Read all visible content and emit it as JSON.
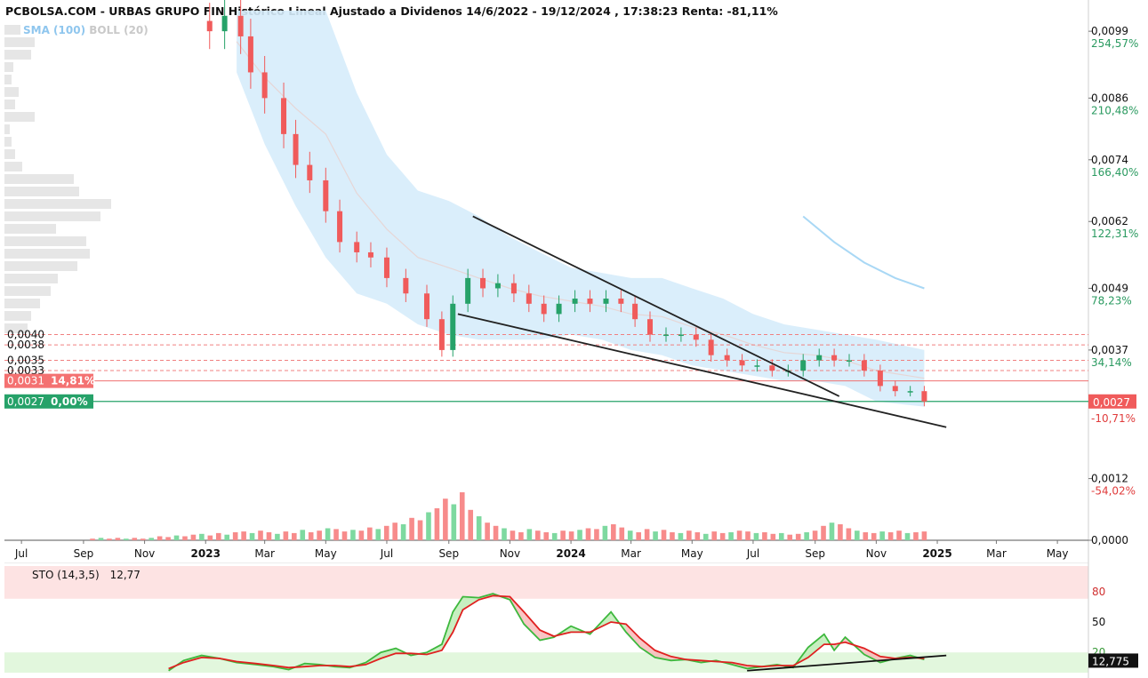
{
  "header": {
    "title": "PCBOLSA.COM - URBAS GRUPO FIN Histórico Lineal Ajustado a Dividenos 14/6/2022 - 19/12/2024 , 17:38:23 Renta: -81,11%",
    "indicator_sma": "SMA (100)",
    "indicator_boll": "BOLL (20)"
  },
  "colors": {
    "up": "#26a269",
    "down": "#f05b5b",
    "volume_up": "#7ed9a0",
    "volume_down": "#f78b8b",
    "bollinger_band": "#d6ecfb",
    "sma": "#a9d8f5",
    "sto_k": "#3db83d",
    "sto_d": "#e02020",
    "trendline": "#222222"
  },
  "chart_data": [
    {
      "type": "candlestick",
      "title": "",
      "ylim": [
        0,
        0.0103
      ],
      "y_ticks": [
        {
          "value": 0.0099,
          "label": "0,0099",
          "pct": "254,57%"
        },
        {
          "value": 0.0086,
          "label": "0,0086",
          "pct": "210,48%"
        },
        {
          "value": 0.0074,
          "label": "0,0074",
          "pct": "166,40%"
        },
        {
          "value": 0.0062,
          "label": "0,0062",
          "pct": "122,31%"
        },
        {
          "value": 0.0049,
          "label": "0,0049",
          "pct": "78,23%"
        },
        {
          "value": 0.0037,
          "label": "0,0037",
          "pct": "34,14%"
        },
        {
          "value": 0.0012,
          "label": "0,0012",
          "pct": "-54,02%"
        },
        {
          "value": 0.0,
          "label": "0,0000",
          "pct": ""
        }
      ],
      "x_ticks": [
        {
          "label": "Jul",
          "date": "2022-07-01",
          "bold": false
        },
        {
          "label": "Sep",
          "date": "2022-09-01",
          "bold": false
        },
        {
          "label": "Nov",
          "date": "2022-11-01",
          "bold": false
        },
        {
          "label": "2023",
          "date": "2023-01-01",
          "bold": true
        },
        {
          "label": "Mar",
          "date": "2023-03-01",
          "bold": false
        },
        {
          "label": "May",
          "date": "2023-05-01",
          "bold": false
        },
        {
          "label": "Jul",
          "date": "2023-07-01",
          "bold": false
        },
        {
          "label": "Sep",
          "date": "2023-09-01",
          "bold": false
        },
        {
          "label": "Nov",
          "date": "2023-11-01",
          "bold": false
        },
        {
          "label": "2024",
          "date": "2024-01-01",
          "bold": true
        },
        {
          "label": "Mar",
          "date": "2024-03-01",
          "bold": false
        },
        {
          "label": "May",
          "date": "2024-05-01",
          "bold": false
        },
        {
          "label": "Jul",
          "date": "2024-07-01",
          "bold": false
        },
        {
          "label": "Sep",
          "date": "2024-09-01",
          "bold": false
        },
        {
          "label": "Nov",
          "date": "2024-11-01",
          "bold": false
        },
        {
          "label": "2025",
          "date": "2025-01-01",
          "bold": true
        },
        {
          "label": "Mar",
          "date": "2025-03-01",
          "bold": false
        },
        {
          "label": "May",
          "date": "2025-05-01",
          "bold": false
        }
      ],
      "x_range": [
        "2022-06-14",
        "2025-06-01"
      ],
      "last_price": {
        "label": "0,0027",
        "pct": "-10,71%",
        "value": 0.0027
      },
      "price_levels": [
        {
          "value": 0.004,
          "label": "0,0040",
          "style": "dashed"
        },
        {
          "value": 0.0038,
          "label": "0,0038",
          "style": "dashed"
        },
        {
          "value": 0.0035,
          "label": "0,0035",
          "style": "dashed"
        },
        {
          "value": 0.0033,
          "label": "0,0033",
          "style": "dashed"
        },
        {
          "value": 0.0031,
          "label": "0,0031",
          "pct": "14,81%",
          "style": "solid-red"
        },
        {
          "value": 0.0027,
          "label": "0,0027",
          "pct": "0,00%",
          "style": "solid-green"
        }
      ],
      "close_points": [
        [
          "2022-12-28",
          0.0101
        ],
        [
          "2023-01-05",
          0.0099
        ],
        [
          "2023-01-20",
          0.0102
        ],
        [
          "2023-02-05",
          0.0098
        ],
        [
          "2023-02-15",
          0.0091
        ],
        [
          "2023-03-01",
          0.0086
        ],
        [
          "2023-03-20",
          0.0079
        ],
        [
          "2023-04-01",
          0.0073
        ],
        [
          "2023-04-15",
          0.007
        ],
        [
          "2023-05-01",
          0.0064
        ],
        [
          "2023-05-15",
          0.0058
        ],
        [
          "2023-06-01",
          0.0056
        ],
        [
          "2023-06-15",
          0.0055
        ],
        [
          "2023-07-01",
          0.0051
        ],
        [
          "2023-07-20",
          0.0048
        ],
        [
          "2023-08-10",
          0.0043
        ],
        [
          "2023-08-25",
          0.0037
        ],
        [
          "2023-09-05",
          0.0046
        ],
        [
          "2023-09-20",
          0.0051
        ],
        [
          "2023-10-05",
          0.0049
        ],
        [
          "2023-10-20",
          0.005
        ],
        [
          "2023-11-05",
          0.0048
        ],
        [
          "2023-11-20",
          0.0046
        ],
        [
          "2023-12-05",
          0.0044
        ],
        [
          "2023-12-20",
          0.0046
        ],
        [
          "2024-01-05",
          0.0047
        ],
        [
          "2024-01-20",
          0.0046
        ],
        [
          "2024-02-05",
          0.0047
        ],
        [
          "2024-02-20",
          0.0046
        ],
        [
          "2024-03-05",
          0.0043
        ],
        [
          "2024-03-20",
          0.004
        ],
        [
          "2024-04-05",
          0.004
        ],
        [
          "2024-04-20",
          0.004
        ],
        [
          "2024-05-05",
          0.0039
        ],
        [
          "2024-05-20",
          0.0036
        ],
        [
          "2024-06-05",
          0.0035
        ],
        [
          "2024-06-20",
          0.0034
        ],
        [
          "2024-07-05",
          0.0034
        ],
        [
          "2024-07-20",
          0.0033
        ],
        [
          "2024-08-05",
          0.0033
        ],
        [
          "2024-08-20",
          0.0035
        ],
        [
          "2024-09-05",
          0.0036
        ],
        [
          "2024-09-20",
          0.0035
        ],
        [
          "2024-10-05",
          0.0035
        ],
        [
          "2024-10-20",
          0.0033
        ],
        [
          "2024-11-05",
          0.003
        ],
        [
          "2024-11-20",
          0.0029
        ],
        [
          "2024-12-05",
          0.0029
        ],
        [
          "2024-12-19",
          0.0027
        ]
      ],
      "bollinger_upper": [
        [
          "2023-02-01",
          0.0103
        ],
        [
          "2023-03-01",
          0.0103
        ],
        [
          "2023-04-01",
          0.0103
        ],
        [
          "2023-05-01",
          0.0103
        ],
        [
          "2023-06-01",
          0.0087
        ],
        [
          "2023-07-01",
          0.0075
        ],
        [
          "2023-08-01",
          0.0068
        ],
        [
          "2023-09-01",
          0.0066
        ],
        [
          "2023-10-01",
          0.0063
        ],
        [
          "2023-11-01",
          0.0059
        ],
        [
          "2023-12-01",
          0.0056
        ],
        [
          "2024-01-01",
          0.0053
        ],
        [
          "2024-02-01",
          0.0052
        ],
        [
          "2024-03-01",
          0.0051
        ],
        [
          "2024-04-01",
          0.0051
        ],
        [
          "2024-05-01",
          0.0049
        ],
        [
          "2024-06-01",
          0.0047
        ],
        [
          "2024-07-01",
          0.0044
        ],
        [
          "2024-08-01",
          0.0042
        ],
        [
          "2024-09-01",
          0.0041
        ],
        [
          "2024-10-01",
          0.004
        ],
        [
          "2024-11-01",
          0.0039
        ],
        [
          "2024-12-19",
          0.0037
        ]
      ],
      "bollinger_lower": [
        [
          "2023-02-01",
          0.0091
        ],
        [
          "2023-03-01",
          0.0077
        ],
        [
          "2023-04-01",
          0.0065
        ],
        [
          "2023-05-01",
          0.0055
        ],
        [
          "2023-06-01",
          0.0048
        ],
        [
          "2023-07-01",
          0.0046
        ],
        [
          "2023-08-01",
          0.0042
        ],
        [
          "2023-09-01",
          0.004
        ],
        [
          "2023-10-01",
          0.0039
        ],
        [
          "2023-11-01",
          0.0039
        ],
        [
          "2023-12-01",
          0.0039
        ],
        [
          "2024-01-01",
          0.004
        ],
        [
          "2024-02-01",
          0.0039
        ],
        [
          "2024-03-01",
          0.0037
        ],
        [
          "2024-04-01",
          0.0036
        ],
        [
          "2024-05-01",
          0.0034
        ],
        [
          "2024-06-01",
          0.0033
        ],
        [
          "2024-07-01",
          0.0032
        ],
        [
          "2024-08-01",
          0.0031
        ],
        [
          "2024-09-01",
          0.0031
        ],
        [
          "2024-10-01",
          0.003
        ],
        [
          "2024-11-01",
          0.0027
        ],
        [
          "2024-12-19",
          0.0026
        ]
      ],
      "sma_points": [
        [
          "2024-08-20",
          0.0063
        ],
        [
          "2024-09-20",
          0.0058
        ],
        [
          "2024-10-20",
          0.0054
        ],
        [
          "2024-11-20",
          0.0051
        ],
        [
          "2024-12-19",
          0.0049
        ]
      ],
      "trendlines": [
        [
          [
            "2023-09-25",
            0.0063
          ],
          [
            "2024-09-25",
            0.0028
          ]
        ],
        [
          [
            "2023-09-10",
            0.0044
          ],
          [
            "2025-01-10",
            0.0022
          ]
        ]
      ],
      "volume": {
        "max_value": 100,
        "bars_relative": [
          2,
          3,
          2,
          3,
          2,
          3,
          2,
          3,
          5,
          4,
          6,
          5,
          7,
          8,
          6,
          9,
          7,
          10,
          11,
          9,
          12,
          10,
          8,
          11,
          9,
          13,
          10,
          12,
          15,
          14,
          11,
          13,
          12,
          16,
          14,
          18,
          22,
          20,
          28,
          25,
          35,
          40,
          52,
          45,
          60,
          38,
          30,
          22,
          18,
          15,
          12,
          10,
          14,
          12,
          10,
          9,
          12,
          11,
          13,
          15,
          14,
          18,
          20,
          16,
          12,
          10,
          14,
          11,
          13,
          10,
          9,
          12,
          10,
          8,
          11,
          9,
          10,
          12,
          11,
          9,
          10,
          8,
          9,
          7,
          8,
          10,
          12,
          18,
          22,
          20,
          15,
          12,
          10,
          9,
          11,
          10,
          12,
          9,
          10,
          11
        ]
      }
    },
    {
      "type": "line",
      "title": "",
      "label": "STO (14,3,5)",
      "value_label": "12,77",
      "last_value_tag": "12,775",
      "ylim": [
        0,
        100
      ],
      "y_ticks": [
        80,
        50,
        20
      ],
      "overbought": 80,
      "oversold": 20,
      "k_points": [
        [
          "2022-11-25",
          2
        ],
        [
          "2022-12-10",
          12
        ],
        [
          "2022-12-28",
          17
        ],
        [
          "2023-01-15",
          14
        ],
        [
          "2023-02-01",
          10
        ],
        [
          "2023-02-20",
          8
        ],
        [
          "2023-03-10",
          6
        ],
        [
          "2023-03-25",
          3
        ],
        [
          "2023-04-10",
          9
        ],
        [
          "2023-04-25",
          8
        ],
        [
          "2023-05-10",
          6
        ],
        [
          "2023-05-25",
          5
        ],
        [
          "2023-06-10",
          10
        ],
        [
          "2023-06-25",
          20
        ],
        [
          "2023-07-10",
          24
        ],
        [
          "2023-07-25",
          17
        ],
        [
          "2023-08-10",
          20
        ],
        [
          "2023-08-25",
          28
        ],
        [
          "2023-09-05",
          60
        ],
        [
          "2023-09-15",
          75
        ],
        [
          "2023-10-01",
          74
        ],
        [
          "2023-10-15",
          78
        ],
        [
          "2023-11-01",
          72
        ],
        [
          "2023-11-15",
          48
        ],
        [
          "2023-12-01",
          32
        ],
        [
          "2023-12-15",
          35
        ],
        [
          "2024-01-01",
          46
        ],
        [
          "2024-01-20",
          38
        ],
        [
          "2024-02-10",
          60
        ],
        [
          "2024-02-25",
          40
        ],
        [
          "2024-03-10",
          25
        ],
        [
          "2024-03-25",
          15
        ],
        [
          "2024-04-10",
          12
        ],
        [
          "2024-04-25",
          13
        ],
        [
          "2024-05-10",
          10
        ],
        [
          "2024-05-25",
          12
        ],
        [
          "2024-06-10",
          8
        ],
        [
          "2024-06-25",
          4
        ],
        [
          "2024-07-10",
          6
        ],
        [
          "2024-07-25",
          8
        ],
        [
          "2024-08-10",
          5
        ],
        [
          "2024-08-25",
          25
        ],
        [
          "2024-09-10",
          38
        ],
        [
          "2024-09-20",
          22
        ],
        [
          "2024-10-01",
          35
        ],
        [
          "2024-10-20",
          18
        ],
        [
          "2024-11-05",
          10
        ],
        [
          "2024-11-20",
          14
        ],
        [
          "2024-12-05",
          17
        ],
        [
          "2024-12-19",
          13
        ]
      ],
      "d_points": [
        [
          "2022-11-25",
          4
        ],
        [
          "2022-12-10",
          10
        ],
        [
          "2022-12-28",
          15
        ],
        [
          "2023-01-15",
          14
        ],
        [
          "2023-02-01",
          11
        ],
        [
          "2023-02-20",
          9
        ],
        [
          "2023-03-10",
          7
        ],
        [
          "2023-03-25",
          5
        ],
        [
          "2023-04-10",
          6
        ],
        [
          "2023-04-25",
          7
        ],
        [
          "2023-05-10",
          7
        ],
        [
          "2023-05-25",
          6
        ],
        [
          "2023-06-10",
          8
        ],
        [
          "2023-06-25",
          14
        ],
        [
          "2023-07-10",
          19
        ],
        [
          "2023-07-25",
          19
        ],
        [
          "2023-08-10",
          18
        ],
        [
          "2023-08-25",
          22
        ],
        [
          "2023-09-05",
          40
        ],
        [
          "2023-09-15",
          62
        ],
        [
          "2023-10-01",
          72
        ],
        [
          "2023-10-15",
          76
        ],
        [
          "2023-11-01",
          75
        ],
        [
          "2023-11-15",
          60
        ],
        [
          "2023-12-01",
          42
        ],
        [
          "2023-12-15",
          36
        ],
        [
          "2024-01-01",
          40
        ],
        [
          "2024-01-20",
          40
        ],
        [
          "2024-02-10",
          50
        ],
        [
          "2024-02-25",
          48
        ],
        [
          "2024-03-10",
          34
        ],
        [
          "2024-03-25",
          22
        ],
        [
          "2024-04-10",
          16
        ],
        [
          "2024-04-25",
          13
        ],
        [
          "2024-05-10",
          12
        ],
        [
          "2024-05-25",
          11
        ],
        [
          "2024-06-10",
          10
        ],
        [
          "2024-06-25",
          7
        ],
        [
          "2024-07-10",
          6
        ],
        [
          "2024-07-25",
          7
        ],
        [
          "2024-08-10",
          7
        ],
        [
          "2024-08-25",
          15
        ],
        [
          "2024-09-10",
          28
        ],
        [
          "2024-09-20",
          28
        ],
        [
          "2024-10-01",
          30
        ],
        [
          "2024-10-20",
          24
        ],
        [
          "2024-11-05",
          16
        ],
        [
          "2024-11-20",
          14
        ],
        [
          "2024-12-05",
          15
        ],
        [
          "2024-12-19",
          14
        ]
      ],
      "trendline": [
        [
          "2024-06-25",
          2
        ],
        [
          "2025-01-10",
          17
        ]
      ]
    }
  ]
}
